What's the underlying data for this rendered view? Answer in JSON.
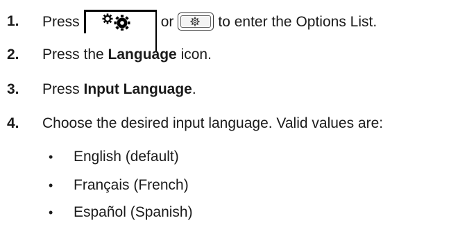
{
  "steps": [
    {
      "num": "1.",
      "pre": "Press",
      "or": "or",
      "post": "to enter the Options List."
    },
    {
      "num": "2.",
      "pre": "Press the ",
      "bold": "Language",
      "post": " icon."
    },
    {
      "num": "3.",
      "pre": "Press ",
      "bold": "Input Language",
      "post": "."
    },
    {
      "num": "4.",
      "text": "Choose the desired input language. Valid values are:"
    }
  ],
  "bullets": [
    {
      "symbol": "•",
      "text": "English (default)"
    },
    {
      "symbol": "•",
      "text": "Français (French)"
    },
    {
      "symbol": "•",
      "text": "Español (Spanish)"
    }
  ],
  "icons": {
    "softkey": "gears-icon",
    "hardkey": "settings-gear-icon"
  }
}
